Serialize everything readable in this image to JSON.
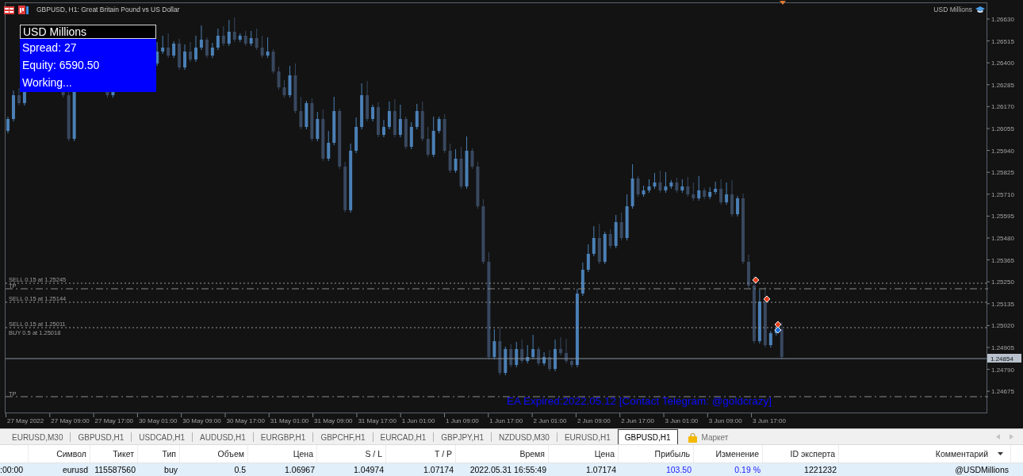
{
  "chart": {
    "title": "GBPUSD, H1: Great Britain Pound vs US Dollar",
    "corner_label": "USD Millions",
    "info_panel": {
      "header": "USD Millions",
      "lines": [
        "Spread: 27",
        "Equity: 6590.50",
        "Working..."
      ]
    },
    "trade_lines": [
      {
        "kind": "order",
        "label": "SELL 0.15 at 1.25245"
      },
      {
        "kind": "take_profit",
        "label": "TP"
      },
      {
        "kind": "order",
        "label": "SELL 0.15 at 1.25144"
      },
      {
        "kind": "order",
        "label": "SELL 0.15 at 1.25011"
      },
      {
        "kind": "order",
        "label": "BUY 0.5 at 1.25018"
      },
      {
        "kind": "take_profit",
        "label": "TP"
      }
    ],
    "trade_markers": [
      {
        "kind": "sell"
      },
      {
        "kind": "sell"
      },
      {
        "kind": "sell"
      },
      {
        "kind": "buy"
      }
    ],
    "comment": "EA Expired:2022.05.12 [Contact Telegram: @goldcrazy]",
    "price_axis": {
      "ticks": [
        "1.26630",
        "1.26515",
        "1.26400",
        "1.26285",
        "1.26170",
        "1.26055",
        "1.25940",
        "1.25825",
        "1.25710",
        "1.25595",
        "1.25480",
        "1.25365",
        "1.25250",
        "1.25135",
        "1.25020",
        "1.24905",
        "1.24790",
        "1.24675"
      ],
      "current_price": "1.24854"
    },
    "time_axis": {
      "labels": [
        "27 May 2022",
        "27 May 09:00",
        "27 May 17:00",
        "30 May 01:00",
        "30 May 09:00",
        "30 May 17:00",
        "31 May 01:00",
        "31 May 09:00",
        "31 May 17:00",
        "1 Jun 01:00",
        "1 Jun 09:00",
        "1 Jun 17:00",
        "2 Jun 01:00",
        "2 Jun 09:00",
        "2 Jun 17:00",
        "3 Jun 01:00",
        "3 Jun 09:00",
        "3 Jun 17:00"
      ]
    }
  },
  "tabs": [
    {
      "label": "EURUSD,M30",
      "selected": false
    },
    {
      "label": "GBPUSD,H1",
      "selected": false
    },
    {
      "label": "USDCAD,H1",
      "selected": false
    },
    {
      "label": "AUDUSD,H1",
      "selected": false
    },
    {
      "label": "EURGBP,H1",
      "selected": false
    },
    {
      "label": "GBPCHF,H1",
      "selected": false
    },
    {
      "label": "EURCAD,H1",
      "selected": false
    },
    {
      "label": "GBPJPY,H1",
      "selected": false
    },
    {
      "label": "NZDUSD,M30",
      "selected": false
    },
    {
      "label": "EURUSD,H1",
      "selected": false
    },
    {
      "label": "GBPUSD,H1",
      "selected": true
    }
  ],
  "market_tab": "Маркет",
  "table": {
    "columns": [
      "Символ",
      "Тикет",
      "Тип",
      "Объем",
      "Цена",
      "S / L",
      "T / P",
      "Время",
      "Цена",
      "Прибыль",
      "Изменение",
      "ID эксперта",
      "Комментарий"
    ],
    "rows": [
      {
        "selected": true,
        "column_1": ":00:00",
        "cells": [
          {
            "text": "eurusd",
            "positive": false
          },
          {
            "text": "115587560",
            "positive": false
          },
          {
            "text": "buy",
            "positive": false
          },
          {
            "text": "0.5",
            "positive": false
          },
          {
            "text": "1.06967",
            "positive": false
          },
          {
            "text": "1.04974",
            "positive": false
          },
          {
            "text": "1.07174",
            "positive": false
          },
          {
            "text": "2022.05.31 16:55:49",
            "positive": false
          },
          {
            "text": "1.07174",
            "positive": false
          },
          {
            "text": "103.50",
            "positive": true
          },
          {
            "text": "0.19 %",
            "positive": true
          },
          {
            "text": "1221232",
            "positive": false
          },
          {
            "text": "@USDMillions",
            "positive": false
          }
        ]
      }
    ]
  }
}
